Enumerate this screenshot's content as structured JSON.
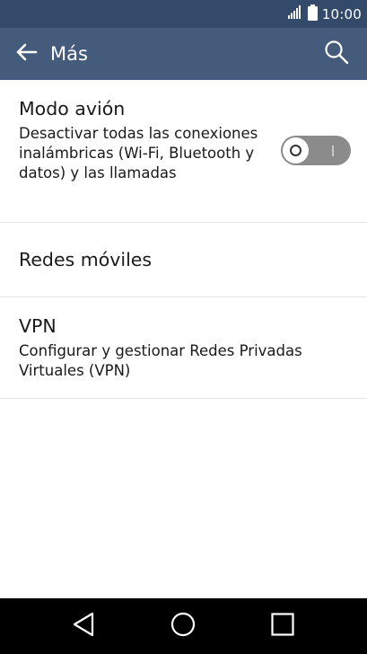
{
  "status_bar": {
    "time": "10:00",
    "signal_icon": "signal-icon",
    "battery_icon": "battery-icon"
  },
  "toolbar": {
    "title": "Más",
    "back_icon": "back-arrow-icon",
    "search_icon": "search-icon"
  },
  "settings": [
    {
      "title": "Modo avión",
      "summary": "Desactivar todas las conexiones inalámbricas (Wi-Fi, Bluetooth y datos) y las llamadas",
      "toggle_state": "off"
    },
    {
      "title": "Redes móviles"
    },
    {
      "title": "VPN",
      "summary": "Configurar y gestionar Redes Privadas Virtuales (VPN)"
    }
  ],
  "nav_bar": {
    "back_icon": "nav-back-icon",
    "home_icon": "nav-home-icon",
    "recents_icon": "nav-recents-icon"
  },
  "colors": {
    "status_bar": "#334a6b",
    "toolbar": "#445b7c",
    "toggle_off": "#8b8b8b",
    "nav_bar": "#000000"
  }
}
